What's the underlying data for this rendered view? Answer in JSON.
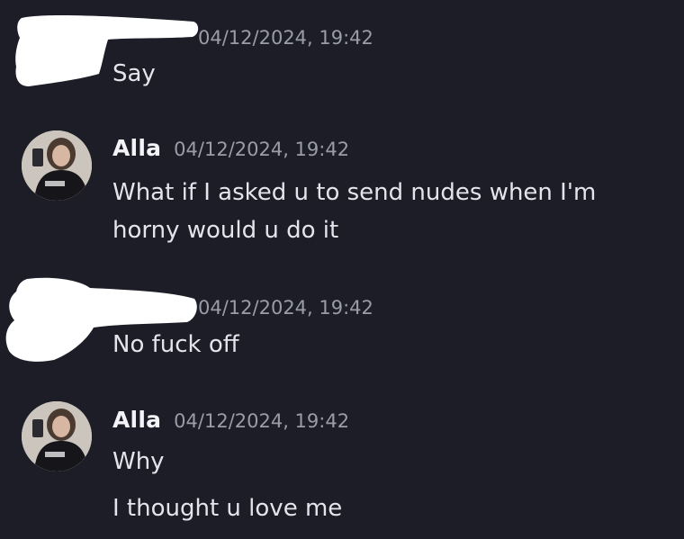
{
  "messages": [
    {
      "author": "",
      "author_redacted": true,
      "timestamp": "04/12/2024, 19:42",
      "lines": [
        "Say"
      ]
    },
    {
      "author": "Alla",
      "author_redacted": false,
      "timestamp": "04/12/2024, 19:42",
      "lines": [
        "What if I asked u to send nudes when I'm",
        "horny would u do it"
      ]
    },
    {
      "author": "",
      "author_redacted": true,
      "timestamp": "04/12/2024, 19:42",
      "lines": [
        "No fuck off"
      ]
    },
    {
      "author": "Alla",
      "author_redacted": false,
      "timestamp": "04/12/2024, 19:42",
      "lines": [
        "Why",
        "I thought u love me"
      ]
    }
  ],
  "colors": {
    "background": "#1c1d26",
    "text": "#e4e4ec",
    "timestamp": "#9a9ca8",
    "redaction": "#ffffff"
  },
  "icons": {
    "avatar": "user-avatar-photo"
  }
}
